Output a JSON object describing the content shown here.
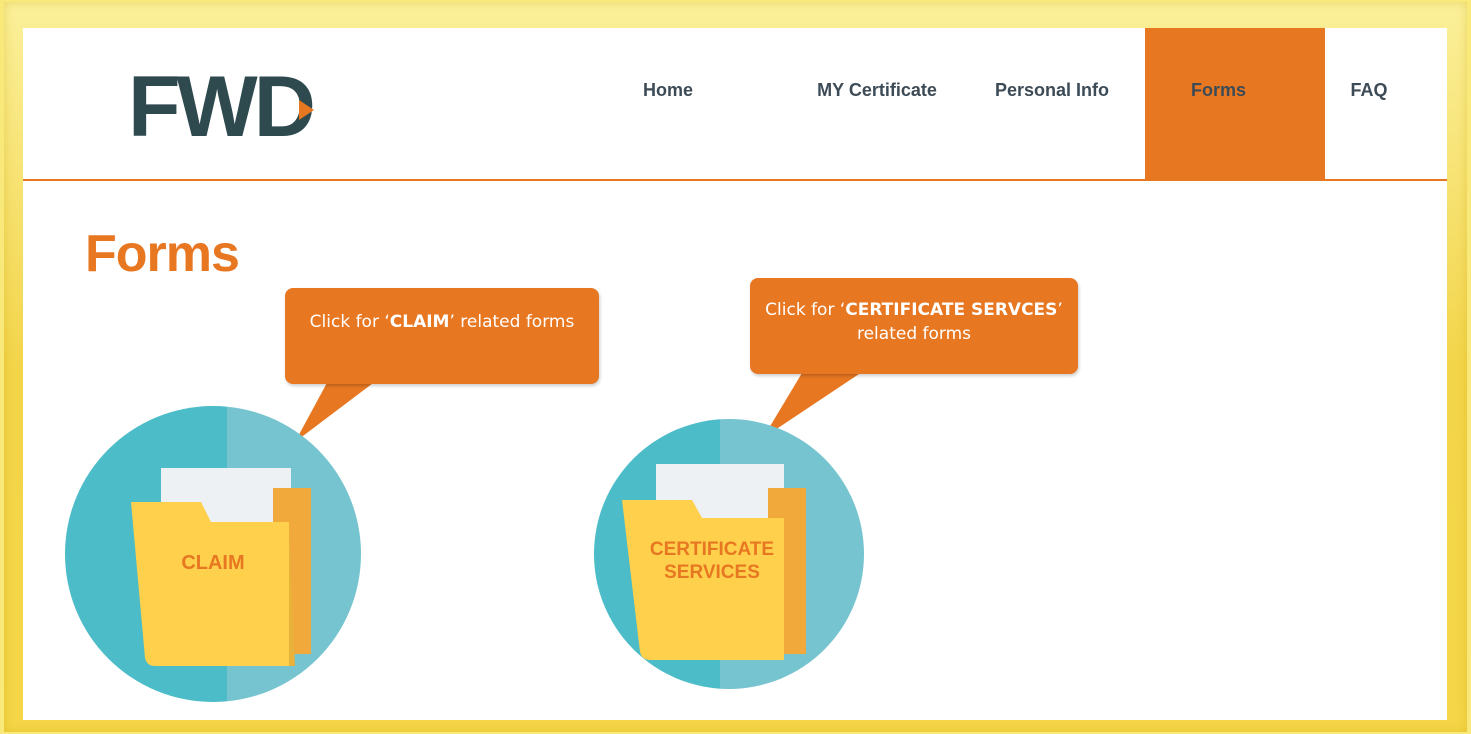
{
  "header": {
    "logo_text": "FWD",
    "nav": [
      {
        "label": "Home"
      },
      {
        "label": "MY Certificate"
      },
      {
        "label": "Personal Info"
      },
      {
        "label": "Forms",
        "active": true
      },
      {
        "label": "FAQ"
      }
    ]
  },
  "main": {
    "title": "Forms",
    "cards": [
      {
        "label": "CLAIM",
        "callout": {
          "prefix": "Click for ‘",
          "bold": "CLAIM",
          "suffix": "’ related forms"
        }
      },
      {
        "label_line1": "CERTIFICATE",
        "label_line2": "SERVICES",
        "callout": {
          "prefix": "Click for ‘",
          "bold": "CERTIFICATE SERVCES",
          "suffix": "’ related forms"
        }
      }
    ]
  },
  "colors": {
    "accent": "#e87722",
    "nav_text": "#3d4b56",
    "logo": "#2f4a4f",
    "circle_dark": "#4bbcc8",
    "circle_light": "#76c4cf",
    "folder": "#fed04b",
    "paper": "#eef1f4",
    "frame": "#f5d648"
  }
}
